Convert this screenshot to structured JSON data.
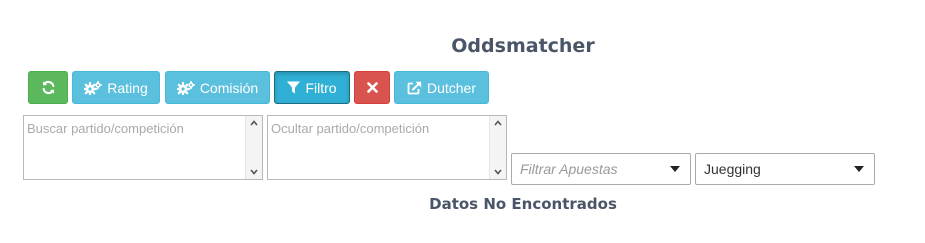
{
  "page": {
    "title": "Oddsmatcher"
  },
  "toolbar": {
    "refresh_icon": "refresh-icon",
    "rating_label": "Rating",
    "rating_icon": "cogs-icon",
    "comision_label": "Comisión",
    "comision_icon": "cogs-icon",
    "filtro_label": "Filtro",
    "filtro_icon": "filter-icon",
    "clear_icon": "close-icon",
    "dutcher_label": "Dutcher",
    "dutcher_icon": "external-link-icon",
    "colors": {
      "green": "#5cb85c",
      "info": "#5bc0de",
      "red": "#d9534f"
    }
  },
  "search": {
    "buscar_placeholder": "Buscar partido/competición",
    "ocultar_placeholder": "Ocultar partido/competición"
  },
  "filters": {
    "apuestas_placeholder": "Filtrar Apuestas",
    "site_selected": "Juegging"
  },
  "results": {
    "empty_text": "Datos No Encontrados"
  }
}
